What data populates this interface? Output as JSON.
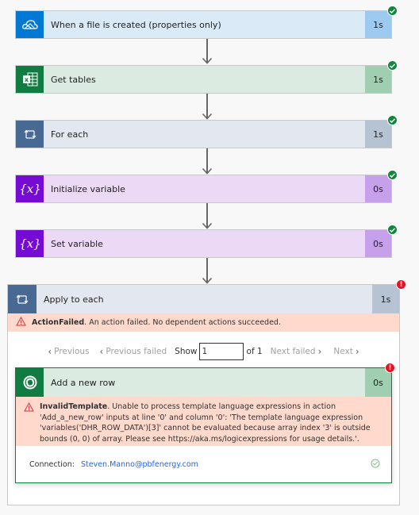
{
  "flow": {
    "steps": [
      {
        "id": "trigger",
        "title": "When a file is created (properties only)",
        "duration": "1s",
        "status": "succeeded",
        "icon": "onedrive-cloud-icon",
        "accent": "#0078d4"
      },
      {
        "id": "get-tables",
        "title": "Get tables",
        "duration": "1s",
        "status": "succeeded",
        "icon": "excel-icon",
        "accent": "#107c41"
      },
      {
        "id": "for-each",
        "title": "For each",
        "duration": "1s",
        "status": "succeeded",
        "icon": "loop-icon",
        "accent": "#486991"
      },
      {
        "id": "init-var",
        "title": "Initialize variable",
        "duration": "0s",
        "status": "succeeded",
        "icon": "variable-icon",
        "accent": "#770bd6"
      },
      {
        "id": "set-var",
        "title": "Set variable",
        "duration": "0s",
        "status": "succeeded",
        "icon": "variable-icon",
        "accent": "#770bd6"
      }
    ],
    "apply_to_each": {
      "title": "Apply to each",
      "duration": "1s",
      "status": "failed",
      "error_code": "ActionFailed",
      "error_message": ". An action failed. No dependent actions succeeded.",
      "pager": {
        "previous": "Previous",
        "previous_failed": "Previous failed",
        "show_label": "Show",
        "current": "1",
        "of_label": "of 1",
        "next_failed": "Next failed",
        "next": "Next"
      },
      "inner_action": {
        "title": "Add a new row",
        "duration": "0s",
        "status": "failed",
        "error_code": "InvalidTemplate",
        "error_message": ". Unable to process template language expressions in action 'Add_a_new_row' inputs at line '0' and column '0': 'The template language expression 'variables('DHR_ROW_DATA')[3]' cannot be evaluated because array index '3' is outside bounds (0, 0) of array. Please see https://aka.ms/logicexpressions for usage details.'.",
        "connection_label": "Connection:",
        "connection_value": "Steven.Manno@pbfenergy.com"
      }
    }
  },
  "colors": {
    "success": "#11873d",
    "error": "#e81123",
    "error_bg": "#fed9cc",
    "link": "#2266e3"
  }
}
